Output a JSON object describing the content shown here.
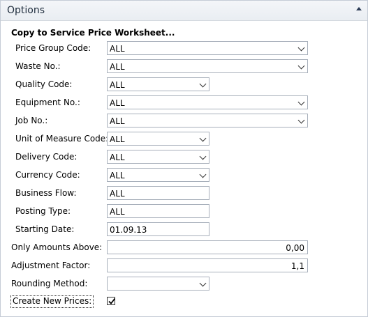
{
  "panel": {
    "title": "Options"
  },
  "section": {
    "title": "Copy to Service Price Worksheet..."
  },
  "fields": {
    "price_group_code": {
      "label": "Price Group Code:",
      "value": "ALL"
    },
    "waste_no": {
      "label": "Waste No.:",
      "value": "ALL"
    },
    "quality_code": {
      "label": "Quality Code:",
      "value": "ALL"
    },
    "equipment_no": {
      "label": "Equipment No.:",
      "value": "ALL"
    },
    "job_no": {
      "label": "Job No.:",
      "value": "ALL"
    },
    "unit_of_measure_code": {
      "label": "Unit of Measure Code:",
      "value": "ALL"
    },
    "delivery_code": {
      "label": "Delivery Code:",
      "value": "ALL"
    },
    "currency_code": {
      "label": "Currency Code:",
      "value": "ALL"
    },
    "business_flow": {
      "label": "Business Flow:",
      "value": "ALL"
    },
    "posting_type": {
      "label": "Posting Type:",
      "value": "ALL"
    },
    "starting_date": {
      "label": "Starting Date:",
      "value": "01.09.13"
    },
    "only_amounts_above": {
      "label": "Only Amounts Above:",
      "value": "0,00"
    },
    "adjustment_factor": {
      "label": "Adjustment Factor:",
      "value": "1,1"
    },
    "rounding_method": {
      "label": "Rounding Method:",
      "value": ""
    },
    "create_new_prices": {
      "label": "Create New Prices:",
      "checked": true
    }
  }
}
